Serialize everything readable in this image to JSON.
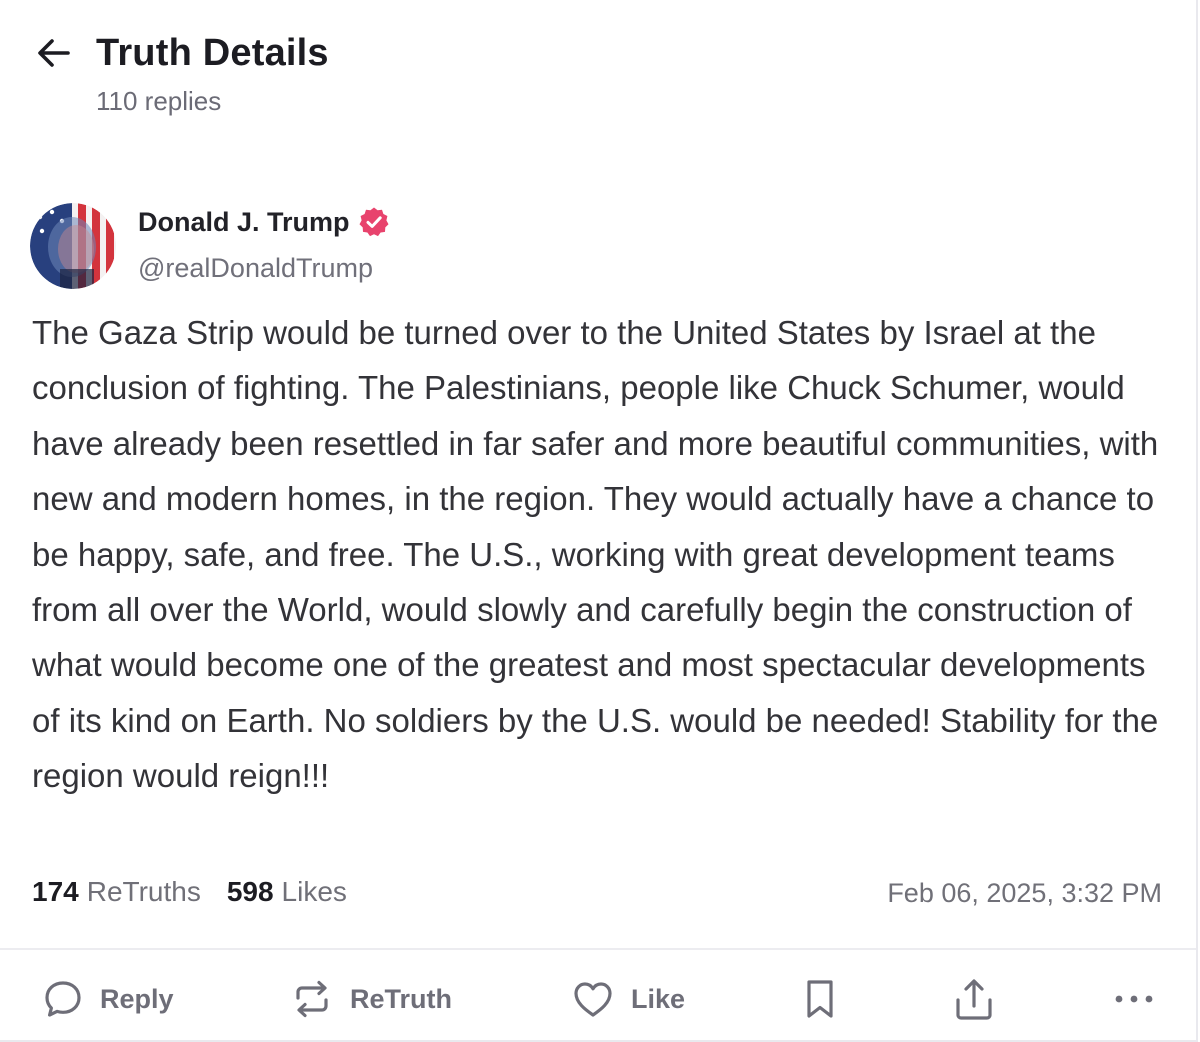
{
  "header": {
    "title": "Truth Details",
    "replies": "110 replies"
  },
  "post": {
    "author_name": "Donald J. Trump",
    "author_handle": "@realDonaldTrump",
    "verified": true,
    "text": "The Gaza Strip would be turned over to the United States by Israel at the conclusion of fighting. The Palestinians, people like Chuck Schumer, would have already been resettled in far safer and more beautiful communities, with new and modern homes, in the region. They would actually have a chance to be happy, safe, and free. The U.S., working with great development teams from all over the World, would slowly and carefully begin the construction of what would become one of the greatest and most spectacular developments of its kind on Earth. No soldiers by the U.S. would be needed! Stability for the region would reign!!!",
    "retruths_count": "174",
    "retruths_label": "ReTruths",
    "likes_count": "598",
    "likes_label": "Likes",
    "timestamp": "Feb 06, 2025, 3:32 PM"
  },
  "actions": {
    "reply_label": "Reply",
    "retruth_label": "ReTruth",
    "like_label": "Like"
  },
  "icons": {
    "back": "arrow-left-icon",
    "verified": "verified-badge-icon",
    "reply": "chat-bubble-icon",
    "retruth": "repeat-arrows-icon",
    "like": "heart-icon",
    "bookmark": "bookmark-icon",
    "share": "share-upload-icon",
    "more": "more-dots-icon"
  },
  "colors": {
    "verified_badge": "#e8436d",
    "text_primary": "#1c1c22",
    "text_secondary": "#707078",
    "icon_gray": "#6e6e78",
    "divider": "#ececf0"
  }
}
